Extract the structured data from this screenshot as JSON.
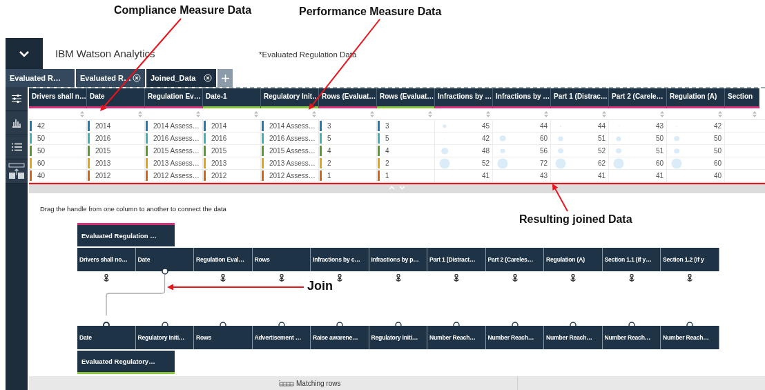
{
  "annotations": [
    {
      "text": "Compliance Measure Data"
    },
    {
      "text": "Performance Measure Data"
    },
    {
      "text": "Resulting joined Data"
    },
    {
      "text": "Join"
    }
  ],
  "header": {
    "title": "IBM Watson Analytics",
    "dataset": "*Evaluated Regulation Data"
  },
  "tabs": [
    {
      "label": "Evaluated R…",
      "selected": false,
      "closable": false
    },
    {
      "label": "Evaluated R…",
      "selected": false,
      "closable": true
    },
    {
      "label": "Joined_Data",
      "selected": true,
      "closable": true
    }
  ],
  "table": {
    "columns": [
      {
        "label": "Drivers shall n…",
        "kind": "category",
        "color": "#d6317a"
      },
      {
        "label": "Date",
        "kind": "category",
        "color": "#d6317a"
      },
      {
        "label": "Regulation Ev…",
        "kind": "category",
        "color": "#d6317a"
      },
      {
        "label": "Date-1",
        "kind": "category",
        "color": "#8cc63f"
      },
      {
        "label": "Regulatory Init…",
        "kind": "category",
        "color": "#8cc63f"
      },
      {
        "label": "Rows (Evaluat…",
        "kind": "category",
        "color": "#d6317a"
      },
      {
        "label": "Rows (Evaluat…",
        "kind": "category",
        "color": "#8cc63f"
      },
      {
        "label": "Infractions by …",
        "kind": "measure",
        "color": "#d6317a"
      },
      {
        "label": "Infractions by …",
        "kind": "measure",
        "color": "#d6317a"
      },
      {
        "label": "Part 1 (Distrac…",
        "kind": "measure",
        "color": "#d6317a"
      },
      {
        "label": "Part 2 (Carele…",
        "kind": "measure",
        "color": "#d6317a"
      },
      {
        "label": "Regulation (A)",
        "kind": "measure",
        "color": "#d6317a"
      },
      {
        "label": "Section",
        "kind": "measure",
        "color": "#d6317a"
      }
    ],
    "rows": [
      {
        "color": "#1f7ab0",
        "cells": [
          "42",
          "2014",
          "2014 Assess…",
          "2014",
          "2014 Assess…",
          "3",
          "3",
          "45",
          "44",
          "44",
          "43",
          "42"
        ]
      },
      {
        "color": "#3bb3b8",
        "cells": [
          "50",
          "2016",
          "2016 Assess…",
          "2016",
          "2016 Assess…",
          "5",
          "5",
          "42",
          "60",
          "51",
          "50",
          "50"
        ]
      },
      {
        "color": "#5a9a2a",
        "cells": [
          "50",
          "2015",
          "2015 Assess…",
          "2015",
          "2015 Assess…",
          "4",
          "4",
          "48",
          "56",
          "52",
          "51",
          "50"
        ]
      },
      {
        "color": "#e0a510",
        "cells": [
          "60",
          "2013",
          "2013 Assess…",
          "2013",
          "2013 Assess…",
          "2",
          "2",
          "52",
          "72",
          "62",
          "60",
          "60"
        ]
      },
      {
        "color": "#d8630f",
        "cells": [
          "40",
          "2012",
          "2012 Assess…",
          "2012",
          "2012 Assess…",
          "1",
          "1",
          "41",
          "43",
          "41",
          "41",
          "40"
        ]
      }
    ]
  },
  "join": {
    "instruction": "Drag the handle from one column to another to connect the data",
    "left_table": {
      "name": "Evaluated Regulation …",
      "columns": [
        {
          "label": "Drivers shall no…",
          "joined": false
        },
        {
          "label": "Date",
          "joined": true
        },
        {
          "label": "Regulation Eval…",
          "joined": false
        },
        {
          "label": "Rows",
          "joined": false
        },
        {
          "label": "Infractions by c…",
          "joined": false
        },
        {
          "label": "Infractions by p…",
          "joined": false
        },
        {
          "label": "Part 1 (Distract…",
          "joined": false
        },
        {
          "label": "Part 2 (Careles…",
          "joined": false
        },
        {
          "label": "Regulation (A)",
          "joined": false
        },
        {
          "label": "Section 1.1 (If y…",
          "joined": false
        },
        {
          "label": "Section 1.2 (If y",
          "joined": false
        }
      ]
    },
    "right_table": {
      "name": "Evaluated Regulatory…",
      "columns": [
        {
          "label": "Date",
          "joined": true
        },
        {
          "label": "Regulatory Initi…",
          "joined": false
        },
        {
          "label": "Rows",
          "joined": false
        },
        {
          "label": "Advertisement …",
          "joined": false
        },
        {
          "label": "Raise awarene…",
          "joined": false
        },
        {
          "label": "Regulatory Initi…",
          "joined": false
        },
        {
          "label": "Number Reach…",
          "joined": false
        },
        {
          "label": "Number Reach…",
          "joined": false
        },
        {
          "label": "Number Reach…",
          "joined": false
        },
        {
          "label": "Number Reach…",
          "joined": false
        },
        {
          "label": "Number Reach…",
          "joined": false
        }
      ]
    }
  },
  "footer": {
    "label": "Matching rows"
  }
}
